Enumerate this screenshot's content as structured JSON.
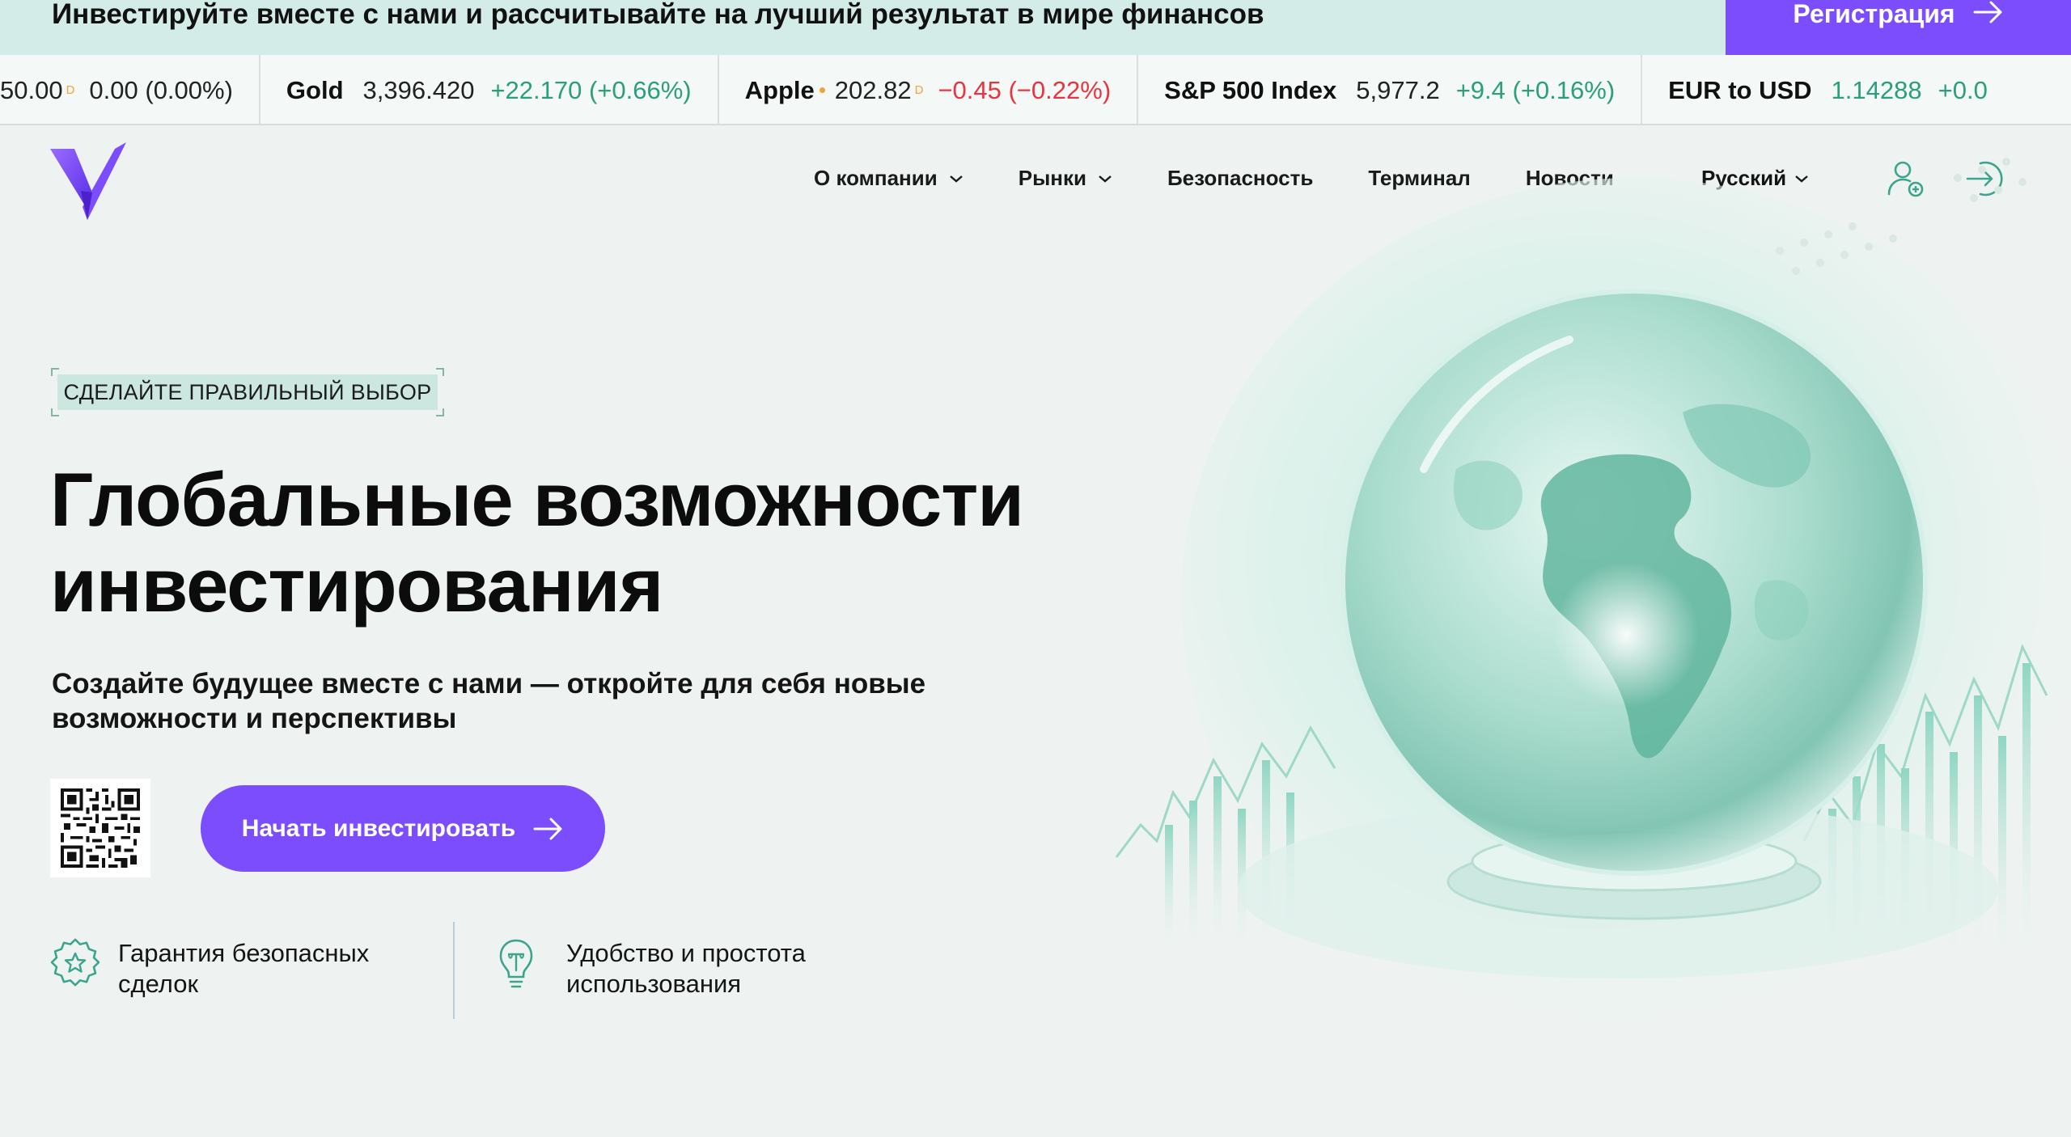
{
  "promo": {
    "text": "Инвестируйте вместе с нами и рассчитывайте на лучший результат в мире финансов",
    "button_label": "Регистрация"
  },
  "ticker": [
    {
      "name": "",
      "price": "50.00",
      "price_mark": "D",
      "change": "0.00 (0.00%)",
      "direction": "flat"
    },
    {
      "name": "Gold",
      "price": "3,396.420",
      "price_mark": "",
      "change": "+22.170 (+0.66%)",
      "direction": "up"
    },
    {
      "name": "Apple",
      "name_dot": true,
      "price": "202.82",
      "price_mark": "D",
      "change": "−0.45 (−0.22%)",
      "direction": "down"
    },
    {
      "name": "S&P 500 Index",
      "price": "5,977.2",
      "price_mark": "",
      "change": "+9.4 (+0.16%)",
      "direction": "up"
    },
    {
      "name": "EUR to USD",
      "price": "1.14288",
      "price_mark": "",
      "change": "+0.0",
      "direction": "up"
    }
  ],
  "nav": {
    "items": [
      {
        "label": "О компании",
        "has_dropdown": true
      },
      {
        "label": "Рынки",
        "has_dropdown": true
      },
      {
        "label": "Безопасность",
        "has_dropdown": false
      },
      {
        "label": "Терминал",
        "has_dropdown": false
      },
      {
        "label": "Новости",
        "has_dropdown": false
      }
    ],
    "language": "Русский",
    "icons": [
      "user-plus-icon",
      "login-icon"
    ]
  },
  "hero": {
    "badge": "СДЕЛАЙТЕ ПРАВИЛЬНЫЙ ВЫБОР",
    "title_line1": "Глобальные возможности",
    "title_line2": "инвестирования",
    "subtitle_line1": "Создайте будущее вместе с нами — откройте для себя новые",
    "subtitle_line2": "возможности и перспективы",
    "cta_label": "Начать инвестировать"
  },
  "features": [
    {
      "icon": "star-badge-icon",
      "line1": "Гарантия безопасных",
      "line2": "сделок"
    },
    {
      "icon": "lightbulb-icon",
      "line1": "Удобство и простота",
      "line2": "использования"
    }
  ],
  "colors": {
    "accent": "#7b4dfc",
    "promo_bg": "#d3ece7",
    "page_bg": "#eef3f1",
    "positive": "#2b9e7d",
    "negative": "#e8343e",
    "teal_icon": "#3aa58c"
  }
}
